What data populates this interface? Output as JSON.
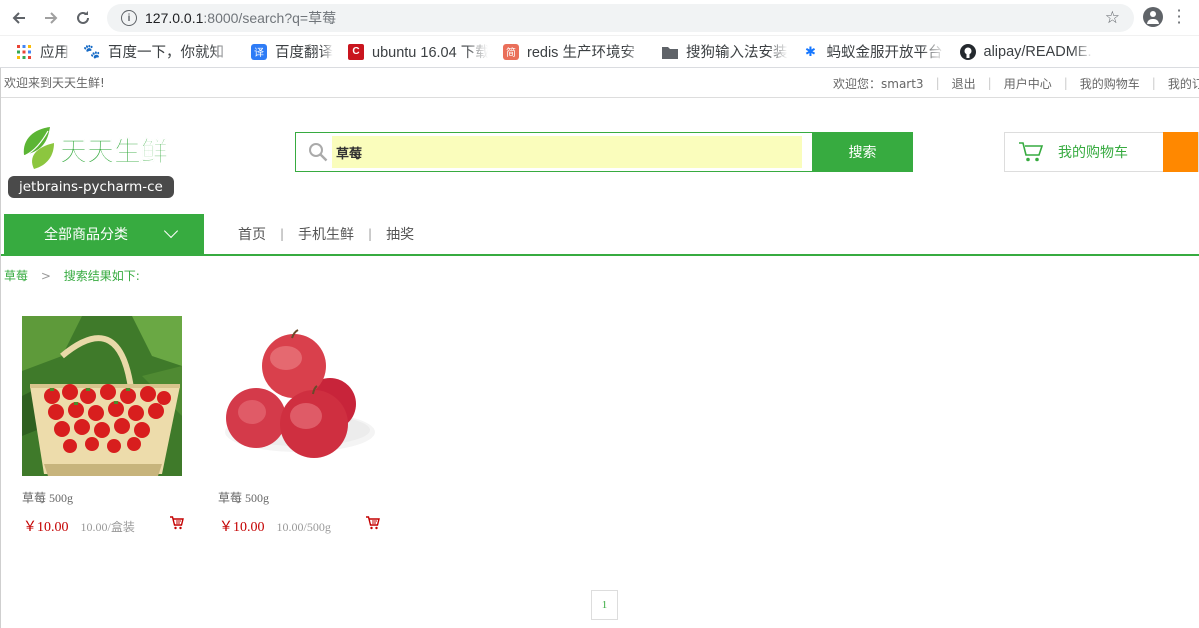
{
  "browser": {
    "url_host": "127.0.0.1",
    "url_path": ":8000/search?q=草莓",
    "bookmarks": [
      {
        "label": "应用",
        "icon": "apps-grid-icon"
      },
      {
        "label": "百度一下，你就知",
        "icon": "baidu-paw-icon"
      },
      {
        "label": "百度翻译",
        "icon": "translate-icon"
      },
      {
        "label": "ubuntu 16.04 下载",
        "icon": "csdn-icon"
      },
      {
        "label": "redis 生产环境安",
        "icon": "jianshu-icon"
      },
      {
        "label": "搜狗输入法安装",
        "icon": "folder-icon"
      },
      {
        "label": "蚂蚁金服开放平台",
        "icon": "antfin-icon"
      },
      {
        "label": "alipay/README.",
        "icon": "github-icon"
      }
    ]
  },
  "topbar": {
    "welcome": "欢迎来到天天生鲜!",
    "greeting": "欢迎您：smart3",
    "logout": "退出",
    "user_center": "用户中心",
    "my_cart": "我的购物车",
    "my_orders": "我的订单"
  },
  "header": {
    "logo_text": "天天生鲜",
    "tooltip": "jetbrains-pycharm-ce",
    "search_value": "草莓",
    "search_button": "搜索",
    "cart_label": "我的购物车"
  },
  "nav": {
    "all_categories": "全部商品分类",
    "links": [
      "首页",
      "手机生鲜",
      "抽奖"
    ]
  },
  "breadcrumb": {
    "category": "草莓",
    "sep": ">",
    "text": "搜索结果如下:"
  },
  "products": [
    {
      "name": "草莓 500g",
      "price": "￥10.00",
      "unit": "10.00/盒装",
      "image": "strawberry-basket"
    },
    {
      "name": "草莓 500g",
      "price": "￥10.00",
      "unit": "10.00/500g",
      "image": "red-apples"
    }
  ],
  "pagination": {
    "current": "1"
  },
  "colors": {
    "brand_green": "#37ab40",
    "price_red": "#c40000",
    "accent_orange": "#ff8800"
  }
}
